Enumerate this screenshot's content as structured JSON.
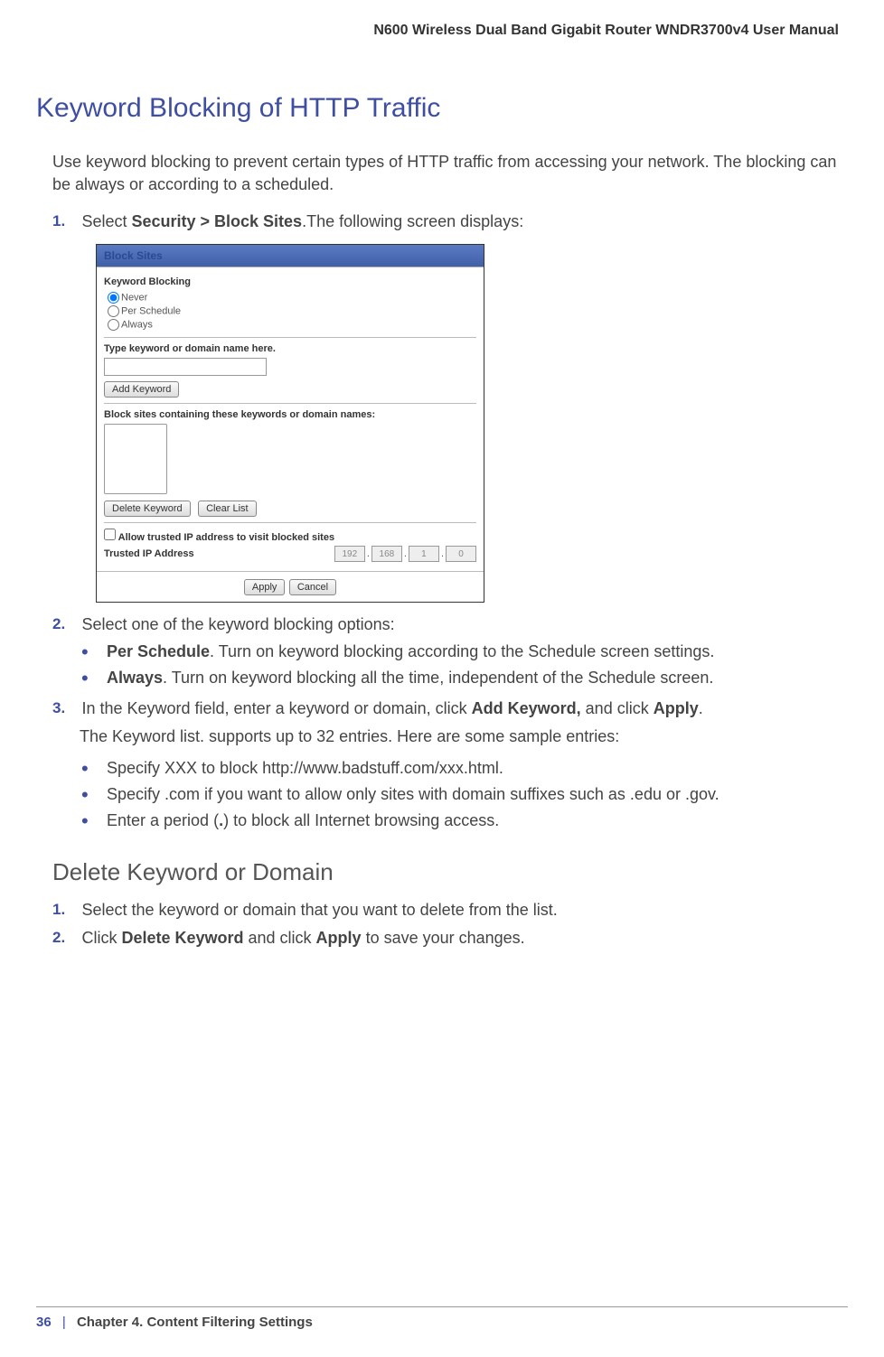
{
  "header": {
    "manual_title": "N600 Wireless Dual Band Gigabit Router WNDR3700v4 User Manual"
  },
  "main": {
    "heading": "Keyword Blocking of HTTP Traffic",
    "intro": "Use keyword blocking to prevent certain types of HTTP traffic from accessing your network. The blocking can be always or according to a scheduled.",
    "step1": {
      "num": "1.",
      "text_prefix": "Select ",
      "text_bold": "Security > Block Sites",
      "text_suffix": ".The following screen displays:"
    },
    "screenshot": {
      "title": "Block Sites",
      "keyword_blocking_label": "Keyword Blocking",
      "radio_never": "Never",
      "radio_per_schedule": "Per Schedule",
      "radio_always": "Always",
      "type_keyword_label": "Type keyword or domain name here.",
      "add_keyword_btn": "Add Keyword",
      "block_sites_label": "Block sites containing these keywords or domain names:",
      "delete_keyword_btn": "Delete Keyword",
      "clear_list_btn": "Clear List",
      "allow_trusted_label": "Allow trusted IP address to visit blocked sites",
      "trusted_ip_label": "Trusted IP Address",
      "ip1": "192",
      "ip2": "168",
      "ip3": "1",
      "ip4": "0",
      "apply_btn": "Apply",
      "cancel_btn": "Cancel"
    },
    "step2": {
      "num": "2.",
      "text": "Select one of the keyword blocking options:",
      "bullet1_bold": "Per Schedule",
      "bullet1_rest": ". Turn on keyword blocking according to the Schedule screen settings.",
      "bullet2_bold": "Always",
      "bullet2_rest": ". Turn on keyword blocking all the time, independent of the Schedule screen."
    },
    "step3": {
      "num": "3.",
      "text_pre": "In the Keyword field, enter a keyword or domain, click ",
      "text_b1": "Add Keyword,",
      "text_mid": " and click ",
      "text_b2": "Apply",
      "text_post": ".",
      "continuation": "The Keyword list. supports up to 32 entries. Here are some sample entries:",
      "bullet1": "Specify XXX to block http://www.badstuff.com/xxx.html.",
      "bullet2": "Specify .com if you want to allow only sites with domain suffixes such as .edu or .gov.",
      "bullet3_pre": "Enter a period (",
      "bullet3_b": ".",
      "bullet3_post": ") to block all Internet browsing access."
    },
    "subheading": "Delete Keyword or Domain",
    "delstep1": {
      "num": "1.",
      "text": "Select the keyword or domain that you want to delete from the list."
    },
    "delstep2": {
      "num": "2.",
      "text_pre": "Click ",
      "text_b1": "Delete Keyword",
      "text_mid": " and click ",
      "text_b2": "Apply",
      "text_post": " to save your changes."
    }
  },
  "footer": {
    "page_number": "36",
    "divider": "|",
    "chapter": "Chapter 4.  Content Filtering Settings"
  }
}
